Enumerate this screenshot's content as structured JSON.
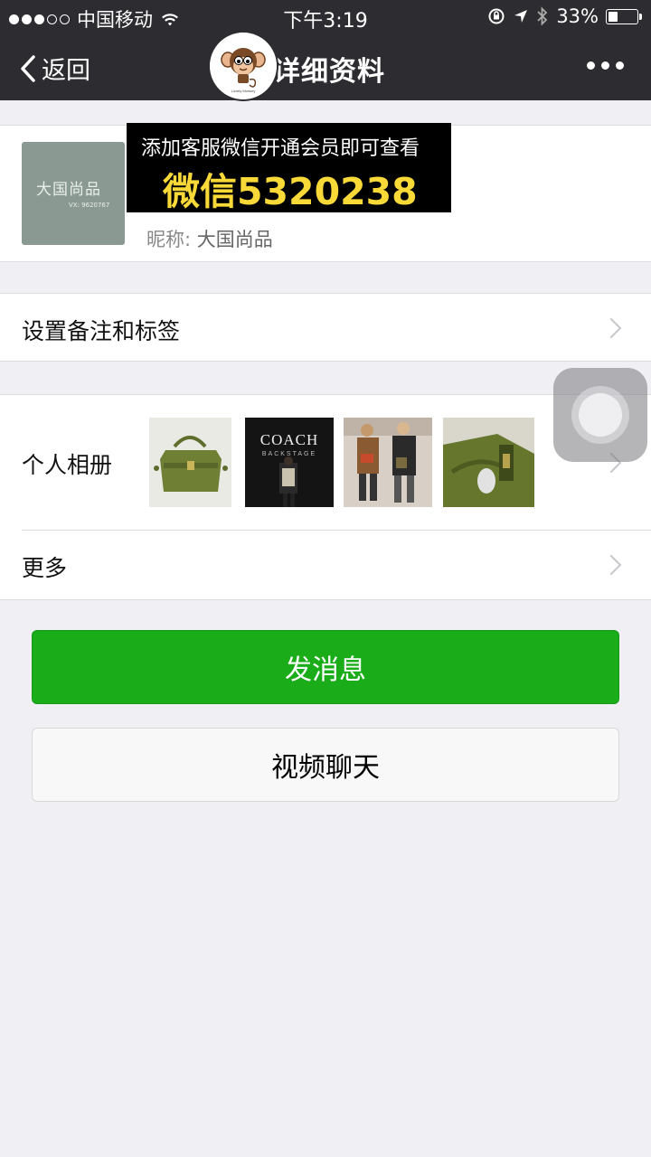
{
  "status_bar": {
    "carrier": "中国移动",
    "time": "下午3:19",
    "battery_text": "33%",
    "battery_level": 0.33,
    "signal_bars_filled": 3,
    "signal_bars_total": 5
  },
  "nav": {
    "back_label": "返回",
    "title": "详细资料",
    "more_icon": "more-dots-icon",
    "logo_text": "Lovely Monkey"
  },
  "profile": {
    "avatar_title": "大国尚品",
    "avatar_sub": "VX: 9620767",
    "banner_line1": "添加客服微信开通会员即可查看",
    "banner_line2": "微信5320238",
    "nickname_label": "昵称:",
    "nickname_value": "大国尚品"
  },
  "rows": {
    "remark_label": "设置备注和标签",
    "album_label": "个人相册",
    "more_label": "更多"
  },
  "album": {
    "coach_brand": "COACH",
    "coach_sub": "BACKSTAGE"
  },
  "buttons": {
    "send_message": "发消息",
    "video_chat": "视频聊天"
  },
  "colors": {
    "nav_bg": "#2d2d31",
    "page_bg": "#efeff4",
    "send_green": "#1aad19",
    "banner_yellow": "#f8d938"
  }
}
